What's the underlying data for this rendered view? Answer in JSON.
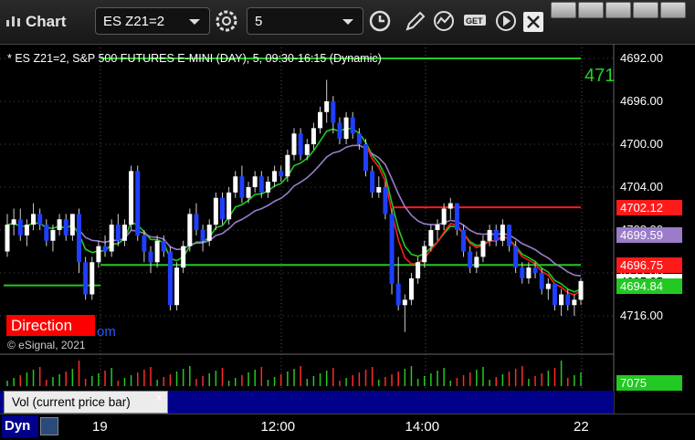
{
  "window": {
    "title": "Chart",
    "symbol": "ES Z21=2",
    "interval": "5"
  },
  "chart_header": "* ES Z21=2, S&P 500 FUTURES E-MINI (DAY), 5, 09:30-16:15 (Dynamic)",
  "price_axis": {
    "ticks": [
      "4716.00",
      "4712.00",
      "4708.00",
      "4704.00",
      "4700.00",
      "4696.00",
      "4692.00"
    ],
    "tags": [
      {
        "label": "4702.12",
        "color": "#ff1a1a"
      },
      {
        "label": "4699.59",
        "color": "#9a7cc8"
      },
      {
        "label": "4696.75",
        "color": "#ff1a1a"
      },
      {
        "label": "4695.25",
        "color": "#ffffff"
      },
      {
        "label": "4694.84",
        "color": "#22c922"
      }
    ],
    "top_right_label": "471"
  },
  "time_axis": [
    "19",
    "12:00",
    "14:00",
    "22"
  ],
  "overlay": {
    "direction_label": "Direction",
    "copyright": "© eSignal, 2021",
    "partial_text": "om"
  },
  "volume": {
    "label": "Vol (current price bar)",
    "close_glyph": "x",
    "value_tag": "7075"
  },
  "bottom": {
    "dyn_label": "Dyn"
  },
  "chart_data": {
    "type": "candlestick",
    "title": "* ES Z21=2, S&P 500 FUTURES E-MINI (DAY), 5, 09:30-16:15 (Dynamic)",
    "ylim": [
      4690,
      4718
    ],
    "yticks": [
      4692,
      4696,
      4700,
      4704,
      4708,
      4712,
      4716
    ],
    "candles": [
      [
        4698.0,
        4701.5,
        4697.5,
        4700.5
      ],
      [
        4700.5,
        4702.0,
        4699.5,
        4701.0
      ],
      [
        4701.0,
        4702.0,
        4699.0,
        4699.5
      ],
      [
        4699.5,
        4701.0,
        4698.5,
        4700.5
      ],
      [
        4700.5,
        4702.5,
        4700.0,
        4701.5
      ],
      [
        4701.5,
        4702.0,
        4700.0,
        4700.5
      ],
      [
        4700.5,
        4701.0,
        4698.5,
        4699.0
      ],
      [
        4699.0,
        4700.5,
        4698.0,
        4700.0
      ],
      [
        4700.0,
        4701.5,
        4699.5,
        4701.0
      ],
      [
        4701.0,
        4701.5,
        4699.0,
        4699.5
      ],
      [
        4699.5,
        4701.5,
        4699.0,
        4701.5
      ],
      [
        4701.5,
        4702.0,
        4696.0,
        4697.0
      ],
      [
        4697.0,
        4697.5,
        4693.5,
        4694.0
      ],
      [
        4694.0,
        4697.5,
        4693.5,
        4697.0
      ],
      [
        4697.0,
        4699.0,
        4696.5,
        4698.5
      ],
      [
        4698.5,
        4699.5,
        4697.5,
        4698.0
      ],
      [
        4698.0,
        4701.0,
        4697.5,
        4700.5
      ],
      [
        4700.5,
        4701.5,
        4698.5,
        4699.0
      ],
      [
        4699.0,
        4701.0,
        4698.5,
        4700.5
      ],
      [
        4700.5,
        4706.0,
        4700.0,
        4705.5
      ],
      [
        4705.5,
        4706.0,
        4699.0,
        4699.5
      ],
      [
        4699.5,
        4700.0,
        4697.0,
        4698.0
      ],
      [
        4698.0,
        4698.5,
        4696.0,
        4697.0
      ],
      [
        4697.0,
        4699.5,
        4696.5,
        4699.0
      ],
      [
        4699.0,
        4699.5,
        4697.5,
        4698.0
      ],
      [
        4698.0,
        4698.5,
        4692.5,
        4693.0
      ],
      [
        4693.0,
        4697.0,
        4692.5,
        4696.5
      ],
      [
        4696.5,
        4699.0,
        4696.0,
        4698.5
      ],
      [
        4698.5,
        4702.0,
        4698.0,
        4701.5
      ],
      [
        4701.5,
        4702.5,
        4699.5,
        4700.0
      ],
      [
        4700.0,
        4700.5,
        4698.0,
        4699.0
      ],
      [
        4699.0,
        4701.0,
        4698.5,
        4700.5
      ],
      [
        4700.5,
        4703.5,
        4700.0,
        4703.0
      ],
      [
        4703.0,
        4703.5,
        4700.5,
        4701.0
      ],
      [
        4701.0,
        4704.0,
        4700.5,
        4703.5
      ],
      [
        4703.5,
        4705.5,
        4703.0,
        4705.0
      ],
      [
        4705.0,
        4706.0,
        4702.5,
        4703.0
      ],
      [
        4703.0,
        4704.5,
        4702.5,
        4704.0
      ],
      [
        4704.0,
        4705.5,
        4703.5,
        4705.0
      ],
      [
        4705.0,
        4705.5,
        4703.0,
        4703.5
      ],
      [
        4703.5,
        4705.0,
        4703.0,
        4704.5
      ],
      [
        4704.5,
        4706.0,
        4704.0,
        4705.5
      ],
      [
        4705.5,
        4706.0,
        4704.5,
        4705.0
      ],
      [
        4705.0,
        4707.5,
        4704.5,
        4707.0
      ],
      [
        4707.0,
        4709.5,
        4706.5,
        4709.0
      ],
      [
        4709.0,
        4709.5,
        4706.5,
        4707.0
      ],
      [
        4707.0,
        4708.5,
        4706.5,
        4708.0
      ],
      [
        4708.0,
        4710.0,
        4707.5,
        4709.5
      ],
      [
        4709.5,
        4711.5,
        4709.0,
        4711.0
      ],
      [
        4711.0,
        4714.0,
        4710.0,
        4712.0
      ],
      [
        4712.0,
        4712.5,
        4709.0,
        4710.0
      ],
      [
        4710.0,
        4710.5,
        4708.0,
        4708.5
      ],
      [
        4708.5,
        4711.0,
        4708.0,
        4710.5
      ],
      [
        4710.5,
        4711.0,
        4708.5,
        4709.0
      ],
      [
        4709.0,
        4709.5,
        4707.5,
        4708.0
      ],
      [
        4708.0,
        4708.5,
        4705.0,
        4705.5
      ],
      [
        4705.5,
        4706.0,
        4703.0,
        4703.5
      ],
      [
        4703.5,
        4705.0,
        4703.0,
        4704.0
      ],
      [
        4704.0,
        4704.5,
        4701.0,
        4701.5
      ],
      [
        4701.5,
        4702.0,
        4694.0,
        4695.0
      ],
      [
        4695.0,
        4697.5,
        4692.5,
        4693.0
      ],
      [
        4693.0,
        4694.0,
        4690.5,
        4693.5
      ],
      [
        4693.5,
        4696.0,
        4693.0,
        4695.5
      ],
      [
        4695.5,
        4697.5,
        4695.0,
        4697.0
      ],
      [
        4697.0,
        4699.0,
        4696.5,
        4698.5
      ],
      [
        4698.5,
        4700.5,
        4698.0,
        4700.0
      ],
      [
        4700.0,
        4701.0,
        4699.0,
        4700.5
      ],
      [
        4700.5,
        4702.5,
        4700.0,
        4702.0
      ],
      [
        4702.0,
        4703.0,
        4701.0,
        4702.5
      ],
      [
        4702.5,
        4702.5,
        4699.5,
        4700.0
      ],
      [
        4700.0,
        4700.5,
        4697.5,
        4698.0
      ],
      [
        4698.0,
        4698.5,
        4696.0,
        4696.5
      ],
      [
        4696.5,
        4698.0,
        4696.0,
        4697.5
      ],
      [
        4697.5,
        4699.5,
        4697.0,
        4699.0
      ],
      [
        4699.0,
        4700.5,
        4698.5,
        4700.0
      ],
      [
        4700.0,
        4700.5,
        4698.5,
        4699.0
      ],
      [
        4699.0,
        4701.0,
        4698.5,
        4700.5
      ],
      [
        4700.5,
        4700.5,
        4698.0,
        4698.5
      ],
      [
        4698.5,
        4699.0,
        4696.0,
        4696.5
      ],
      [
        4696.5,
        4697.0,
        4695.0,
        4695.5
      ],
      [
        4695.5,
        4697.0,
        4695.0,
        4696.5
      ],
      [
        4696.5,
        4697.0,
        4695.5,
        4696.0
      ],
      [
        4696.0,
        4696.5,
        4694.0,
        4694.5
      ],
      [
        4694.5,
        4695.5,
        4693.5,
        4695.0
      ],
      [
        4695.0,
        4695.0,
        4692.5,
        4693.0
      ],
      [
        4693.0,
        4694.5,
        4692.0,
        4694.0
      ],
      [
        4694.0,
        4694.5,
        4692.5,
        4693.0
      ],
      [
        4693.0,
        4694.0,
        4692.0,
        4693.5
      ],
      [
        4693.5,
        4695.5,
        4693.0,
        4695.25
      ]
    ],
    "series": [
      {
        "color": "#22c922",
        "kind": "ma"
      },
      {
        "color": "#ff1a1a",
        "kind": "ma"
      },
      {
        "color": "#9a7cc8",
        "kind": "ma"
      },
      {
        "color": "#22c922",
        "kind": "level"
      }
    ],
    "levels": [
      {
        "value": 4716.0,
        "color": "#22c922"
      },
      {
        "value": 4702.12,
        "color": "#ff1a1a"
      },
      {
        "value": 4696.75,
        "color": "#ff1a1a"
      },
      {
        "value": 4694.84,
        "color": "#22c922"
      }
    ],
    "volume_max": 7075
  }
}
